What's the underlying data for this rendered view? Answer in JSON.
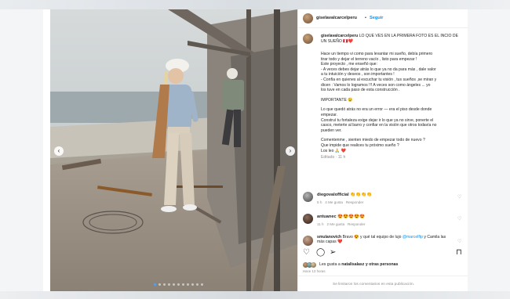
{
  "account": {
    "username": "giselavalcarcelperu",
    "dot": "•",
    "follow_label": "Seguir"
  },
  "caption": {
    "username": "giselavalcarcelperu",
    "headline": "LO QUE VES EN LA PRIMERA FOTO ES EL INCIO DE UN SUEÑO 🇵🇪❤️",
    "lines": [
      "Hace un tiempo vi como para levantar mi sueño, debía primero",
      "tirar todo y dejar el terreno vacío , listo para empezar !",
      "Este proyecto , me enseñó que:",
      "- A veces debes dejar atrás lo que ya no da para más , dale valor",
      "a tu intuición y deseos , son importantes !",
      "- Confía en quienes al escuchar tu visión , tus sueños ,se miran y",
      "dicen : Vamos lo logramos !!! A veces son como ángeles ... yo",
      "los tuve en cada paso de esta construcción ."
    ],
    "important": "IMPORTANTE 😉",
    "lines2": [
      "Lo que quedó atrás no era un error — era el piso desde donde",
      "empezar.",
      "Construí tu fortaleza exige dejar ir lo que ya no sirve, ponerte el",
      "casco, meterte al barro y confiar en la visión que otros todavía no",
      "pueden ver."
    ],
    "lines3": [
      "Comentenme , sienten miedo de empezar todo de nuevo ?",
      "Que impide que realices tu próximo sueño ?",
      "Los leo 🙏 ❤️"
    ],
    "edited": "Editado · 11 h"
  },
  "comments": [
    {
      "user": "diegovalofficial",
      "text": "👏👏👏👏",
      "time": "5 h",
      "likes": "4 Me gusta",
      "reply": "Responder"
    },
    {
      "user": "antuanec",
      "text": "😍😍😍😍😍",
      "time": "11 h",
      "likes": "2 Me gusta",
      "reply": "Responder"
    },
    {
      "user": "smulanovich",
      "text": "Bravo 😍 y qué tal equipo de lujo",
      "mention": "@marcelftp",
      "text2": "y Camila las más capas ❤️",
      "time": "9 h",
      "likes": "2 Me gusta",
      "reply": "Responder"
    }
  ],
  "likes": {
    "prefix": "Les gusta a",
    "user": "natalisalasz",
    "suffix": "y otras personas",
    "time": "Hace 13 horas"
  },
  "footer": {
    "text": "Se limitaron los comentarios en esta publicación."
  },
  "colors": {
    "link": "#0095f6",
    "text": "#262626",
    "muted": "#8e8e8e"
  }
}
